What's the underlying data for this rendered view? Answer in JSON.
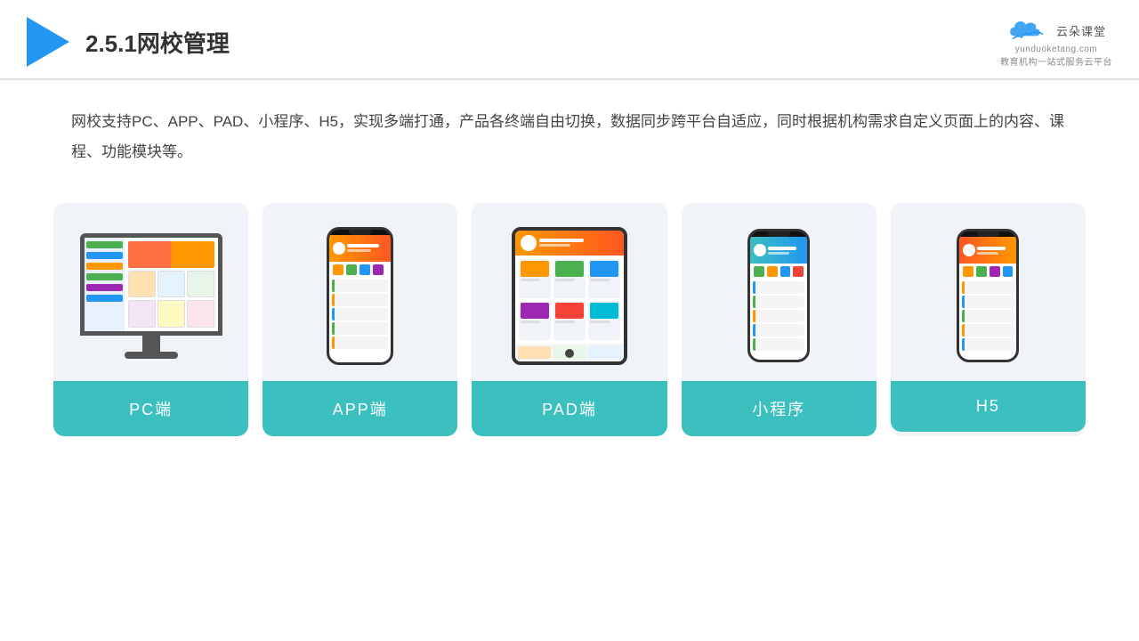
{
  "header": {
    "title": "2.5.1网校管理",
    "brand_name": "云朵课堂",
    "brand_url": "yunduoketang.com",
    "brand_slogan": "教育机构一站式服务云平台"
  },
  "description": {
    "text": "网校支持PC、APP、PAD、小程序、H5，实现多端打通，产品各终端自由切换，数据同步跨平台自适应，同时根据机构需求自定义页面上的内容、课程、功能模块等。"
  },
  "cards": [
    {
      "id": "pc",
      "label": "PC端"
    },
    {
      "id": "app",
      "label": "APP端"
    },
    {
      "id": "pad",
      "label": "PAD端"
    },
    {
      "id": "miniprogram",
      "label": "小程序"
    },
    {
      "id": "h5",
      "label": "H5"
    }
  ],
  "colors": {
    "accent": "#3BBFBF",
    "header_border": "#e0e0e0",
    "card_bg": "#f0f4f8",
    "triangle": "#2196F3"
  }
}
